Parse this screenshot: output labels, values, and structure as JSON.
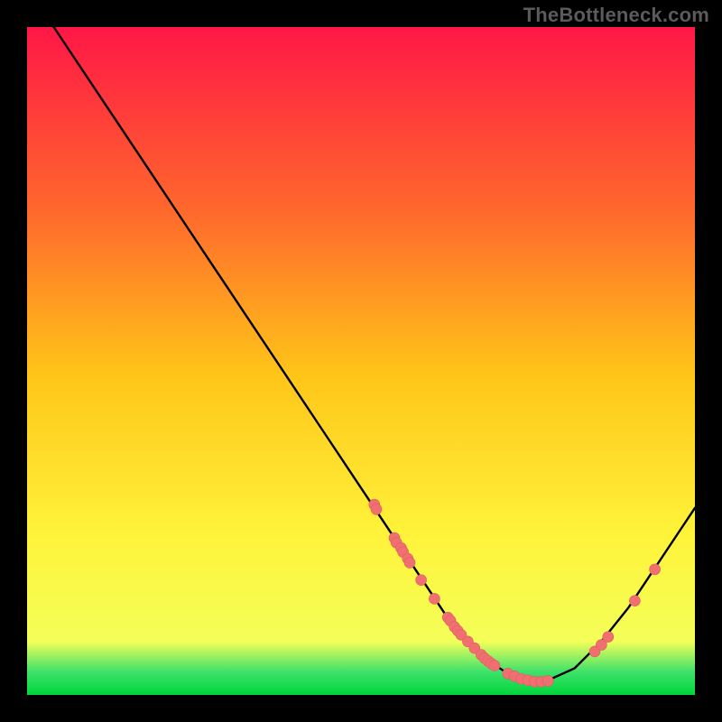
{
  "watermark": "TheBottleneck.com",
  "colors": {
    "background": "#000000",
    "grad_top": "#ff1746",
    "grad_q1": "#ff6a2c",
    "grad_mid": "#ffc518",
    "grad_q3": "#fff33a",
    "grad_low": "#f3ff58",
    "grad_bottom_band": "#3fe26b",
    "grad_bottom_line": "#00d63b",
    "curve": "#000000",
    "marker_fill": "#f07072",
    "marker_stroke": "#e35b5e"
  },
  "chart_data": {
    "type": "line",
    "title": "",
    "xlabel": "",
    "ylabel": "",
    "xlim": [
      0,
      100
    ],
    "ylim": [
      0,
      100
    ],
    "series": [
      {
        "name": "bottleneck-curve",
        "x": [
          4,
          8,
          12,
          16,
          20,
          24,
          28,
          32,
          36,
          40,
          44,
          48,
          52,
          56,
          58,
          60,
          62,
          64,
          66,
          68,
          70,
          72,
          74,
          76,
          78,
          82,
          86,
          90,
          94,
          98,
          100
        ],
        "y": [
          100,
          94,
          88,
          82,
          76,
          70,
          64,
          58,
          52,
          46,
          40,
          34,
          28,
          22,
          19,
          16,
          13,
          10,
          8,
          6,
          4.5,
          3.2,
          2.4,
          2,
          2.2,
          4,
          8,
          13,
          19,
          25,
          28
        ]
      }
    ],
    "markers": {
      "name": "highlight-points",
      "x": [
        52,
        52.3,
        55,
        55.3,
        56,
        56.3,
        57,
        57.3,
        59,
        61,
        63,
        63.4,
        64,
        64.5,
        65,
        66,
        67,
        68,
        68.5,
        69,
        69.5,
        70,
        72,
        73,
        74,
        75,
        76,
        77,
        78,
        85,
        86,
        87,
        91,
        94
      ],
      "y": [
        28.5,
        27.8,
        23.5,
        22.8,
        22,
        21.4,
        20.4,
        19.8,
        17.2,
        14.4,
        11.6,
        11.1,
        10.2,
        9.6,
        9.0,
        8.0,
        7.0,
        6.0,
        5.5,
        5.1,
        4.7,
        4.4,
        3.2,
        2.8,
        2.4,
        2.2,
        2.0,
        2.0,
        2.1,
        6.5,
        7.5,
        8.7,
        14.1,
        18.8
      ],
      "r": 6
    }
  }
}
